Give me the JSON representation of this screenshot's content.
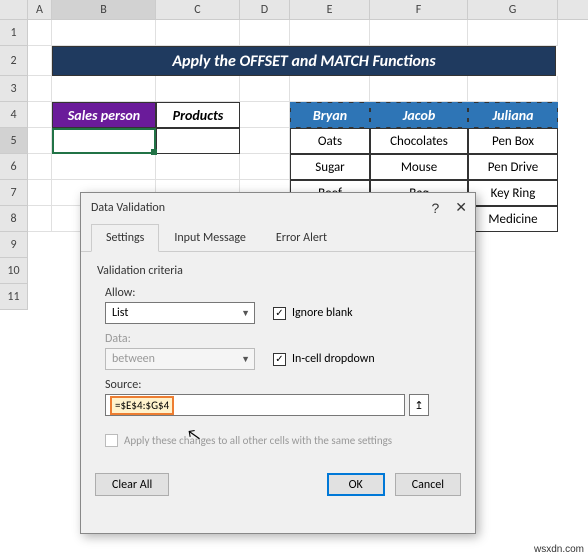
{
  "columns": [
    "A",
    "B",
    "C",
    "D",
    "E",
    "F",
    "G"
  ],
  "row_numbers": [
    "1",
    "2",
    "3",
    "4",
    "5",
    "6",
    "7",
    "8",
    "9",
    "10",
    "11"
  ],
  "banner": "Apply the OFFSET and MATCH Functions",
  "table_left": {
    "headers": [
      "Sales person",
      "Products"
    ]
  },
  "table_right": {
    "headers": [
      "Bryan",
      "Jacob",
      "Juliana"
    ],
    "rows": [
      [
        "Oats",
        "Chocolates",
        "Pen Box"
      ],
      [
        "Sugar",
        "Mouse",
        "Pen Drive"
      ],
      [
        "Beef",
        "Bag",
        "Key Ring"
      ],
      [
        "",
        "",
        "Medicine"
      ]
    ]
  },
  "dialog": {
    "title": "Data Validation",
    "tabs": [
      "Settings",
      "Input Message",
      "Error Alert"
    ],
    "criteria_label": "Validation criteria",
    "allow_label": "Allow:",
    "allow_value": "List",
    "data_label": "Data:",
    "data_value": "between",
    "ignore_blank": "Ignore blank",
    "incell_dropdown": "In-cell dropdown",
    "source_label": "Source:",
    "source_value": "=$E$4:$G$4",
    "apply_text": "Apply these changes to all other cells with the same settings",
    "clear_all": "Clear All",
    "ok": "OK",
    "cancel": "Cancel"
  },
  "watermark": "wsxdn.com"
}
